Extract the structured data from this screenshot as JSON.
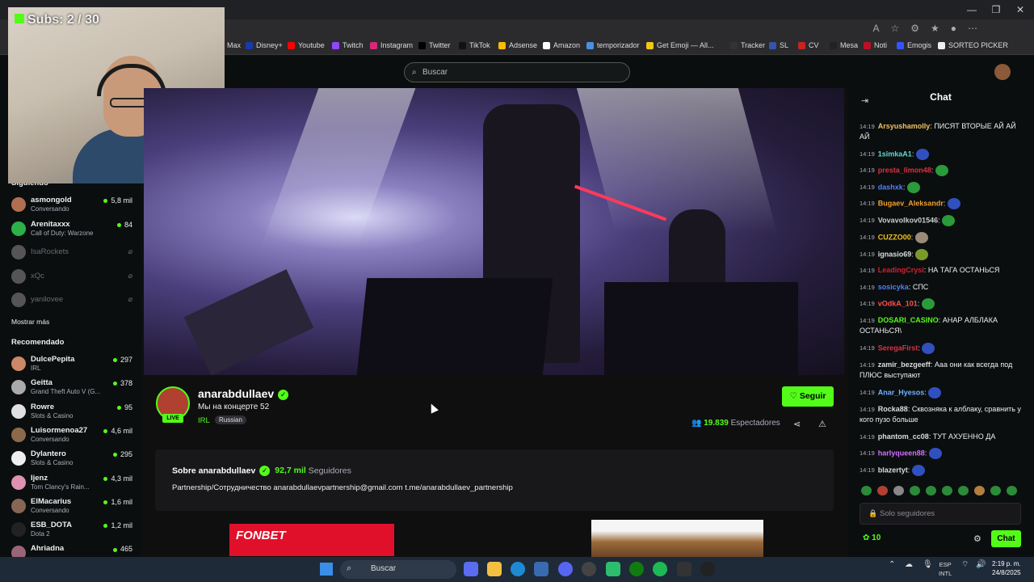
{
  "browser": {
    "bookmarks": [
      {
        "label": "Max",
        "color": "#2a4cff"
      },
      {
        "label": "Disney+",
        "color": "#1a3aaa"
      },
      {
        "label": "Youtube",
        "color": "#ff0000"
      },
      {
        "label": "Twitch",
        "color": "#9146ff"
      },
      {
        "label": "Instagram",
        "color": "#d62976"
      },
      {
        "label": "Twitter",
        "color": "#000000"
      },
      {
        "label": "TikTok",
        "color": "#111111"
      },
      {
        "label": "Adsense",
        "color": "#fbbc04"
      },
      {
        "label": "Amazon",
        "color": "#ffffff"
      },
      {
        "label": "temporizador",
        "color": "#4a90e2"
      },
      {
        "label": "Get Emoji — All...",
        "color": "#f5c518"
      },
      {
        "label": "Tracker",
        "color": "#333333"
      },
      {
        "label": "SL",
        "color": "#3355aa"
      },
      {
        "label": "CV",
        "color": "#cc2222"
      },
      {
        "label": "Mesa",
        "color": "#222222"
      },
      {
        "label": "Noti",
        "color": "#bb1122"
      },
      {
        "label": "Emogis",
        "color": "#3355ff"
      },
      {
        "label": "SORTEO PICKER",
        "color": "#eeeeee"
      }
    ]
  },
  "overlay": {
    "subs": "Subs: 2 / 30"
  },
  "header": {
    "search_placeholder": "Buscar"
  },
  "sidebar": {
    "following_title": "Siguiendo",
    "following": [
      {
        "name": "asmongold",
        "sub": "Conversando",
        "viewers": "5,8 mil",
        "color": "#b07050",
        "online": true
      },
      {
        "name": "Arenitaxxx",
        "sub": "Call of Duty: Warzone",
        "viewers": "84",
        "color": "#2bb04a",
        "online": true
      },
      {
        "name": "IsaRockets",
        "sub": "",
        "viewers": "",
        "color": "#555555",
        "online": false
      },
      {
        "name": "xQc",
        "sub": "",
        "viewers": "",
        "color": "#555555",
        "online": false
      },
      {
        "name": "yanilovee",
        "sub": "",
        "viewers": "",
        "color": "#555555",
        "online": false
      }
    ],
    "show_more": "Mostrar más",
    "recommended_title": "Recomendado",
    "recommended": [
      {
        "name": "DulcePepita",
        "sub": "IRL",
        "viewers": "297",
        "color": "#cc8866"
      },
      {
        "name": "Geitta",
        "sub": "Grand Theft Auto V (G...",
        "viewers": "378",
        "color": "#aaaaaa"
      },
      {
        "name": "Rowre",
        "sub": "Slots & Casino",
        "viewers": "95",
        "color": "#e0e0e0"
      },
      {
        "name": "Luisormenoa27",
        "sub": "Conversando",
        "viewers": "4,6 mil",
        "color": "#8a6a4a"
      },
      {
        "name": "Dylantero",
        "sub": "Slots & Casino",
        "viewers": "295",
        "color": "#eeeeee"
      },
      {
        "name": "Ijenz",
        "sub": "Tom Clancy's Rain...",
        "viewers": "4,3 mil",
        "color": "#e090b0"
      },
      {
        "name": "ElMacarius",
        "sub": "Conversando",
        "viewers": "1,6 mil",
        "color": "#886655"
      },
      {
        "name": "ESB_DOTA",
        "sub": "Dota 2",
        "viewers": "1,2 mil",
        "color": "#222222"
      },
      {
        "name": "Ahriadna",
        "sub": "",
        "viewers": "465",
        "color": "#996677"
      }
    ]
  },
  "stream": {
    "live_label": "LIVE",
    "channel": "anarabdullaev",
    "title": "Мы на концерте 52",
    "category": "IRL",
    "tag": "Russian",
    "follow_label": "Seguir",
    "viewers": "19.839",
    "viewers_label": "Espectadores"
  },
  "about": {
    "title": "Sobre anarabdullaev",
    "followers": "92,7 mil",
    "followers_label": "Seguidores",
    "description": "Partnership/Сотрудничество anarabdullaevpartnership@gmail.com t.me/anarabdullaev_partnership"
  },
  "ads": {
    "banner1": "FONBET"
  },
  "chat": {
    "title": "Chat",
    "messages": [
      {
        "time": "14:19",
        "user": "Arsyushamolly",
        "color": "#f0c060",
        "text": "ПИСЯТ ВТОРЫЕ АЙ АЙ АЙ",
        "emote": ""
      },
      {
        "time": "14:19",
        "user": "1simkaA1",
        "color": "#60d8d0",
        "text": "",
        "emote": "#3050c0"
      },
      {
        "time": "14:19",
        "user": "presta_limon48",
        "color": "#e03040",
        "text": "",
        "emote": "#2a9a3a"
      },
      {
        "time": "14:19",
        "user": "dashxk",
        "color": "#5080ff",
        "text": "",
        "emote": "#2a9a3a"
      },
      {
        "time": "14:19",
        "user": "Bugaev_Aleksandr",
        "color": "#f0a030",
        "text": "",
        "emote": "#3050c0"
      },
      {
        "time": "14:19",
        "user": "Vovavolkov01546",
        "color": "#cccccc",
        "text": "",
        "emote": "#2a9a3a"
      },
      {
        "time": "14:19",
        "user": "CUZZO00",
        "color": "#f0c020",
        "text": "",
        "emote": "#9a8a7a"
      },
      {
        "time": "14:19",
        "user": "ignasio69",
        "color": "#dddddd",
        "text": "",
        "emote": "#7a9a2a"
      },
      {
        "time": "14:19",
        "user": "LeadingCrysi",
        "color": "#d02030",
        "text": "НА ТАГА ОСТАНЬСЯ",
        "emote": ""
      },
      {
        "time": "14:19",
        "user": "sosicyka",
        "color": "#5080ff",
        "text": "СПС",
        "emote": ""
      },
      {
        "time": "14:19",
        "user": "vOdkA_101",
        "color": "#ff5050",
        "text": "",
        "emote": "#2a9a3a"
      },
      {
        "time": "14:19",
        "user": "DOSARI_CASINO",
        "color": "#53fc18",
        "text": "АНАР АЛБЛАКА ОСТАНЬСЯ\\",
        "emote": ""
      },
      {
        "time": "14:19",
        "user": "SeregaFirst",
        "color": "#e03040",
        "text": "",
        "emote": "#3050c0"
      },
      {
        "time": "14:19",
        "user": "zamir_bezgeeff",
        "color": "#dddddd",
        "text": "Ааа они как всегда под ПЛЮС выступают",
        "emote": ""
      },
      {
        "time": "14:19",
        "user": "Anar_Hyesos",
        "color": "#70b0ff",
        "text": "",
        "emote": "#3050c0"
      },
      {
        "time": "14:19",
        "user": "Rocka88",
        "color": "#dddddd",
        "text": "Сквозняка к алблаку, сравнить у кого пузо больше",
        "emote": ""
      },
      {
        "time": "14:19",
        "user": "phantom_cc08",
        "color": "#dddddd",
        "text": "ТУТ АХУЕННО ДА",
        "emote": ""
      },
      {
        "time": "14:19",
        "user": "harlyqueen88",
        "color": "#d070ff",
        "text": "",
        "emote": "#3050c0"
      },
      {
        "time": "14:19",
        "user": "blazertyt",
        "color": "#dddddd",
        "text": "",
        "emote": "#3050c0"
      }
    ],
    "input_placeholder": "Solo seguidores",
    "points": "10",
    "send_label": "Chat"
  },
  "taskbar": {
    "search_placeholder": "Buscar",
    "lang": "ESP",
    "layout": "INTL",
    "time": "2:19 p. m.",
    "date": "24/8/2025"
  }
}
